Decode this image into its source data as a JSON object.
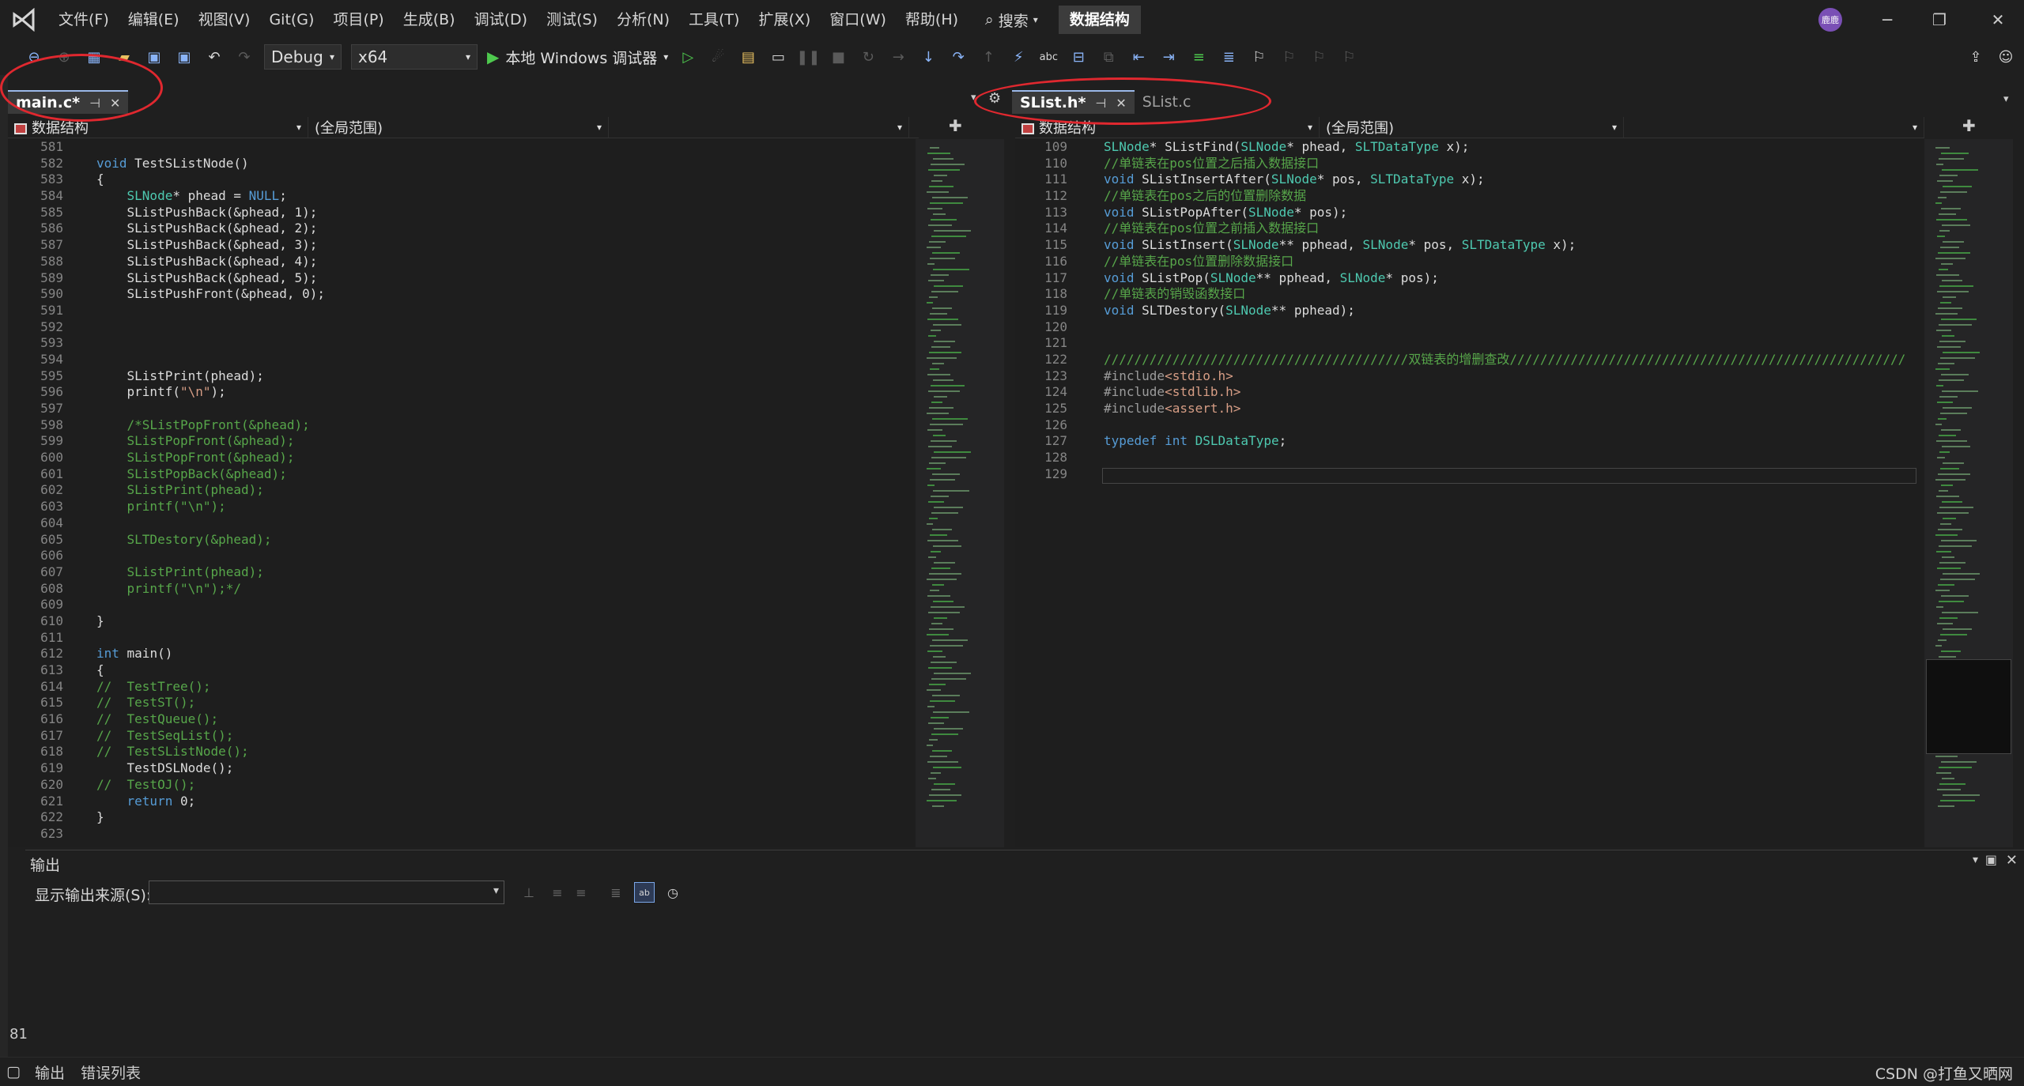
{
  "menu": [
    "文件(F)",
    "编辑(E)",
    "视图(V)",
    "Git(G)",
    "项目(P)",
    "生成(B)",
    "调试(D)",
    "测试(S)",
    "分析(N)",
    "工具(T)",
    "扩展(X)",
    "窗口(W)",
    "帮助(H)"
  ],
  "search_label": "搜索",
  "solution_name": "数据结构",
  "avatar_text": "鹿鹿",
  "toolbar": {
    "config": "Debug",
    "platform": "x64",
    "run_label": "本地 Windows 调试器"
  },
  "left_pane": {
    "tab_label": "main.c*",
    "project": "数据结构",
    "scope": "(全局范围)",
    "lines": [
      {
        "n": "581",
        "t": ""
      },
      {
        "n": "582",
        "t": "void TestSListNode()"
      },
      {
        "n": "583",
        "t": "{"
      },
      {
        "n": "584",
        "t": "    SLNode* phead = NULL;"
      },
      {
        "n": "585",
        "t": "    SListPushBack(&phead, 1);"
      },
      {
        "n": "586",
        "t": "    SListPushBack(&phead, 2);"
      },
      {
        "n": "587",
        "t": "    SListPushBack(&phead, 3);"
      },
      {
        "n": "588",
        "t": "    SListPushBack(&phead, 4);"
      },
      {
        "n": "589",
        "t": "    SListPushBack(&phead, 5);"
      },
      {
        "n": "590",
        "t": "    SListPushFront(&phead, 0);"
      },
      {
        "n": "591",
        "t": ""
      },
      {
        "n": "592",
        "t": ""
      },
      {
        "n": "593",
        "t": ""
      },
      {
        "n": "594",
        "t": ""
      },
      {
        "n": "595",
        "t": "    SListPrint(phead);"
      },
      {
        "n": "596",
        "t": "    printf(\"\\n\");"
      },
      {
        "n": "597",
        "t": ""
      },
      {
        "n": "598",
        "t": "    /*SListPopFront(&phead);"
      },
      {
        "n": "599",
        "t": "    SListPopFront(&phead);"
      },
      {
        "n": "600",
        "t": "    SListPopFront(&phead);"
      },
      {
        "n": "601",
        "t": "    SListPopBack(&phead);"
      },
      {
        "n": "602",
        "t": "    SListPrint(phead);"
      },
      {
        "n": "603",
        "t": "    printf(\"\\n\");"
      },
      {
        "n": "604",
        "t": ""
      },
      {
        "n": "605",
        "t": "    SLTDestory(&phead);"
      },
      {
        "n": "606",
        "t": ""
      },
      {
        "n": "607",
        "t": "    SListPrint(phead);"
      },
      {
        "n": "608",
        "t": "    printf(\"\\n\");*/"
      },
      {
        "n": "609",
        "t": ""
      },
      {
        "n": "610",
        "t": "}"
      },
      {
        "n": "611",
        "t": ""
      },
      {
        "n": "612",
        "t": "int main()"
      },
      {
        "n": "613",
        "t": "{"
      },
      {
        "n": "614",
        "t": "//  TestTree();"
      },
      {
        "n": "615",
        "t": "//  TestST();"
      },
      {
        "n": "616",
        "t": "//  TestQueue();"
      },
      {
        "n": "617",
        "t": "//  TestSeqList();"
      },
      {
        "n": "618",
        "t": "//  TestSListNode();"
      },
      {
        "n": "619",
        "t": "    TestDSLNode();"
      },
      {
        "n": "620",
        "t": "//  TestOJ();"
      },
      {
        "n": "621",
        "t": "    return 0;"
      },
      {
        "n": "622",
        "t": "}"
      },
      {
        "n": "623",
        "t": ""
      }
    ]
  },
  "right_pane": {
    "tab_active": "SList.h*",
    "tab_inactive": "SList.c",
    "project": "数据结构",
    "scope": "(全局范围)",
    "lines": [
      {
        "n": "109",
        "t": "SLNode* SListFind(SLNode* phead, SLTDataType x);"
      },
      {
        "n": "110",
        "t": "//单链表在pos位置之后插入数据接口"
      },
      {
        "n": "111",
        "t": "void SListInsertAfter(SLNode* pos, SLTDataType x);"
      },
      {
        "n": "112",
        "t": "//单链表在pos之后的位置删除数据"
      },
      {
        "n": "113",
        "t": "void SListPopAfter(SLNode* pos);"
      },
      {
        "n": "114",
        "t": "//单链表在pos位置之前插入数据接口"
      },
      {
        "n": "115",
        "t": "void SListInsert(SLNode** pphead, SLNode* pos, SLTDataType x);"
      },
      {
        "n": "116",
        "t": "//单链表在pos位置删除数据接口"
      },
      {
        "n": "117",
        "t": "void SListPop(SLNode** pphead, SLNode* pos);"
      },
      {
        "n": "118",
        "t": "//单链表的销毁函数接口"
      },
      {
        "n": "119",
        "t": "void SLTDestory(SLNode** pphead);"
      },
      {
        "n": "120",
        "t": ""
      },
      {
        "n": "121",
        "t": ""
      },
      {
        "n": "122",
        "t": "////////////////////////////////////////双链表的增删查改////////////////////////////////////////////////////"
      },
      {
        "n": "123",
        "t": "#include<stdio.h>"
      },
      {
        "n": "124",
        "t": "#include<stdlib.h>"
      },
      {
        "n": "125",
        "t": "#include<assert.h>"
      },
      {
        "n": "126",
        "t": ""
      },
      {
        "n": "127",
        "t": "typedef int DSLDataType;"
      },
      {
        "n": "128",
        "t": ""
      },
      {
        "n": "129",
        "t": ""
      }
    ]
  },
  "output": {
    "title": "输出",
    "source_label": "显示输出来源(S):",
    "source_value": ""
  },
  "zoom_indicator": "81",
  "bottom_tabs": [
    "输出",
    "错误列表"
  ],
  "watermark": "CSDN @打鱼又晒网",
  "colors": {
    "annotation": "#e0282f",
    "run": "#4ec94e",
    "editor_bg": "#1e1e1e"
  }
}
